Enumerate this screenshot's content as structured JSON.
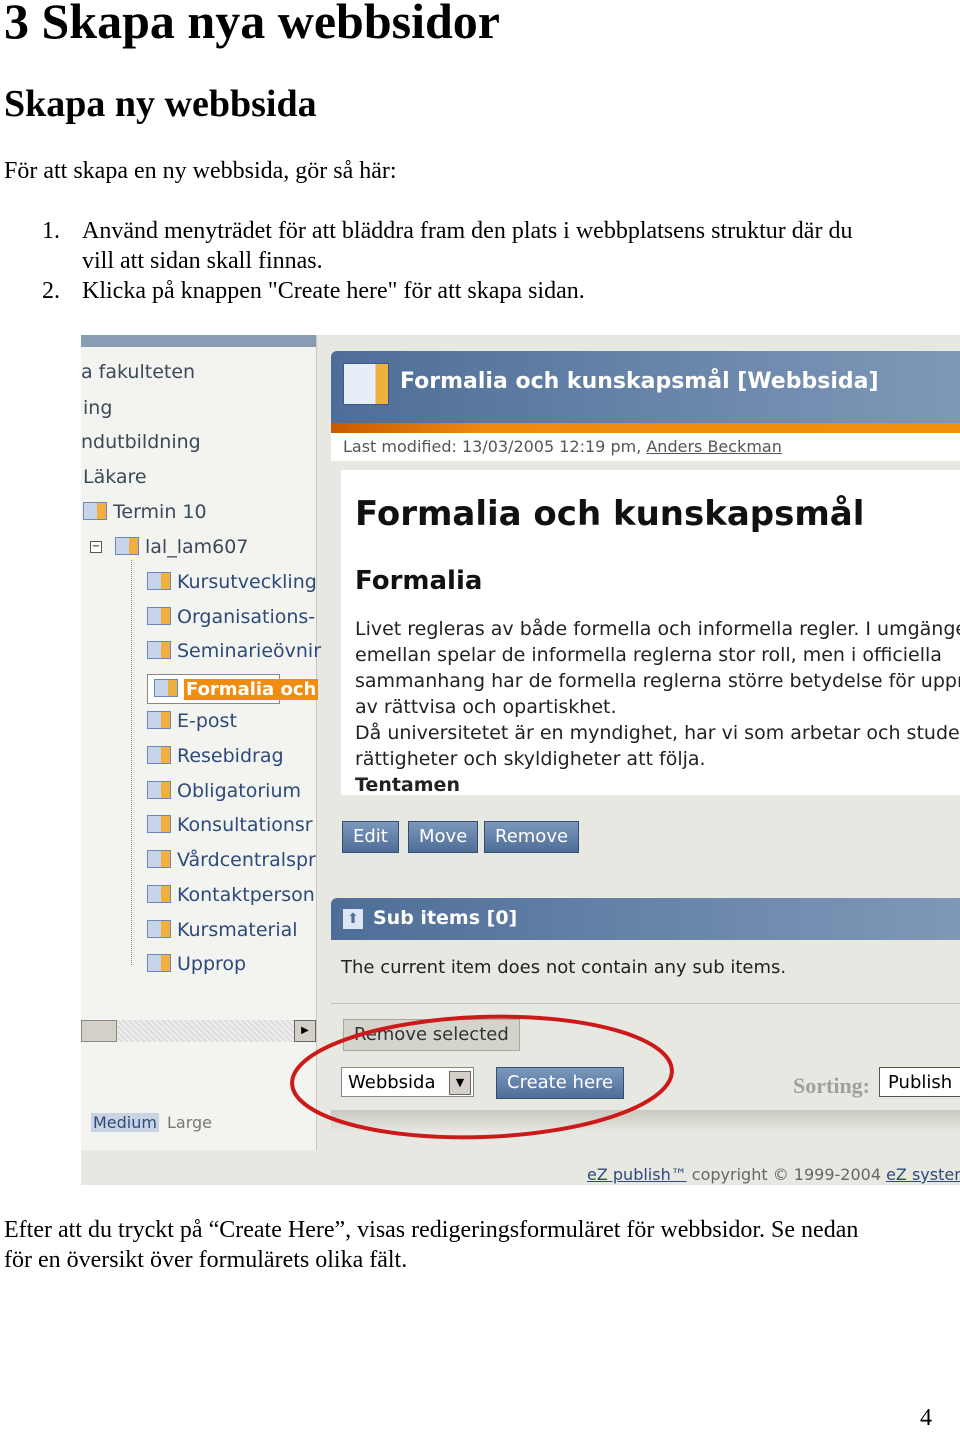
{
  "heading1": "3 Skapa nya webbsidor",
  "heading2": "Skapa ny webbsida",
  "intro": "För att skapa en ny webbsida, gör så här:",
  "steps": [
    {
      "num": "1.",
      "line1": "Använd menyträdet för att bläddra fram den plats i webbplatsens struktur där du",
      "line2": "vill att sidan skall finnas."
    },
    {
      "num": "2.",
      "line1": "Klicka på knappen \"Create here\" för att skapa sidan."
    }
  ],
  "screenshot": {
    "tree": [
      "a fakulteten",
      "ing",
      "ndutbildning",
      "Läkare",
      "Termin 10",
      "lal_lam607",
      "Kursutveckling",
      "Organisations-",
      "Seminarieövnir",
      "Formalia och",
      "E-post",
      "Resebidrag",
      "Obligatorium",
      "Konsultationsr",
      "Vårdcentralspr",
      "Kontaktperson",
      "Kursmaterial",
      "Upprop"
    ],
    "sizes": {
      "medium": "Medium",
      "large": "Large"
    },
    "title": "Formalia och kunskapsmål [Webbsida]",
    "modified_prefix": "Last modified: 13/03/2005 12:19 pm, ",
    "modified_author": "Anders Beckman",
    "content_title": "Formalia och kunskapsmål",
    "content_subtitle": "Formalia",
    "content_lines": [
      "Livet regleras av både formella och informella regler. I umgänget r",
      "emellan spelar de informella reglerna stor roll, men i officiella",
      "sammanhang har de formella reglerna större betydelse för upprätt",
      "av rättvisa och opartiskhet.",
      "Då universitetet är en myndighet, har vi som arbetar och studerar",
      "rättigheter och skyldigheter att följa.",
      "Tentamen"
    ],
    "buttons": {
      "edit": "Edit",
      "move": "Move",
      "remove": "Remove"
    },
    "subitems_title": "Sub items [0]",
    "subitems_text": "The current item does not contain any sub items.",
    "remove_selected": "Remove selected",
    "class_select": "Webbsida",
    "create_here": "Create here",
    "sorting_label": "Sorting:",
    "sorting_value": "Publish",
    "footer": {
      "product": "eZ publish™",
      "copyright": " copyright © 1999-2004 ",
      "company": "eZ system"
    },
    "highlight_color": "#cc1a1a"
  },
  "outro_line1": "Efter att du tryckt på “Create Here”, visas redigeringsformuläret för webbsidor. Se nedan",
  "outro_line2": "för en översikt över formulärets olika fält.",
  "page_number": "4"
}
